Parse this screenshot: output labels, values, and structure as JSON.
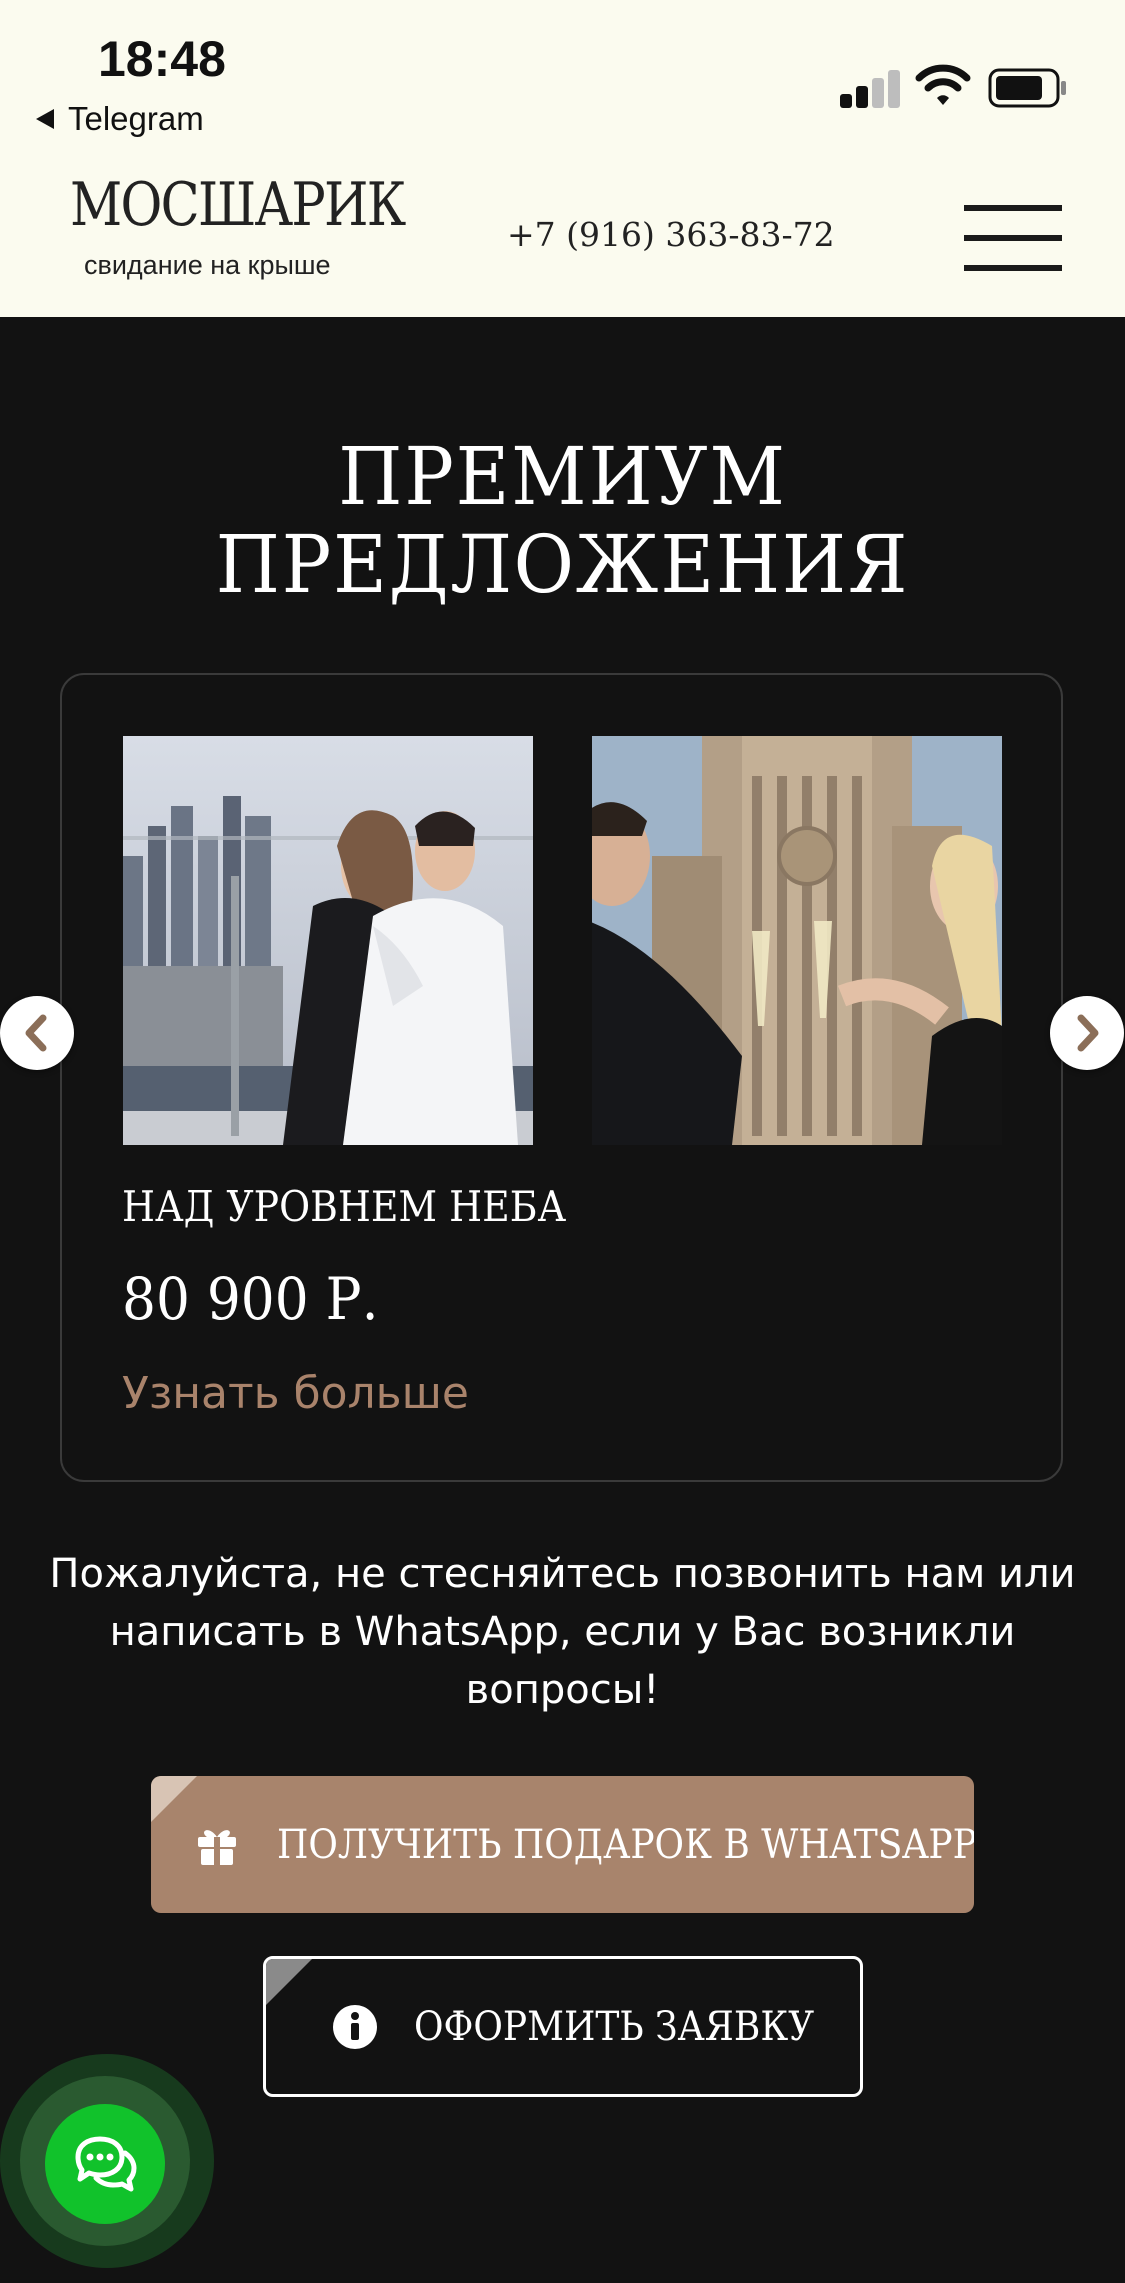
{
  "status_bar": {
    "time": "18:48",
    "back_label": "Telegram"
  },
  "header": {
    "logo": "МОСШАРИК",
    "logo_subtitle": "свидание на крыше",
    "phone": "+7 (916) 363-83-72"
  },
  "section": {
    "title_line1": "ПРЕМИУМ",
    "title_line2": "ПРЕДЛОЖЕНИЯ"
  },
  "carousel": {
    "items": [
      {
        "title": "НАД УРОВНЕМ НЕБА",
        "price": "80 900 Р.",
        "link": "Узнать больше",
        "image": "couple-embracing-on-rooftop-with-city-skyline"
      },
      {
        "image": "couple-toasting-champagne-near-stalinist-building"
      }
    ]
  },
  "contact_note": "Пожалуйста, не стесняйтесь позвонить нам или написать в WhatsApp, если у Вас возникли вопросы!",
  "buttons": {
    "gift": "ПОЛУЧИТЬ ПОДАРОК В WHATSAPP",
    "apply": "ОФОРМИТЬ ЗАЯВКУ"
  },
  "colors": {
    "header_bg": "#fbfbef",
    "page_bg": "#121212",
    "accent": "#a8846c",
    "chat_green": "#11c22b"
  }
}
